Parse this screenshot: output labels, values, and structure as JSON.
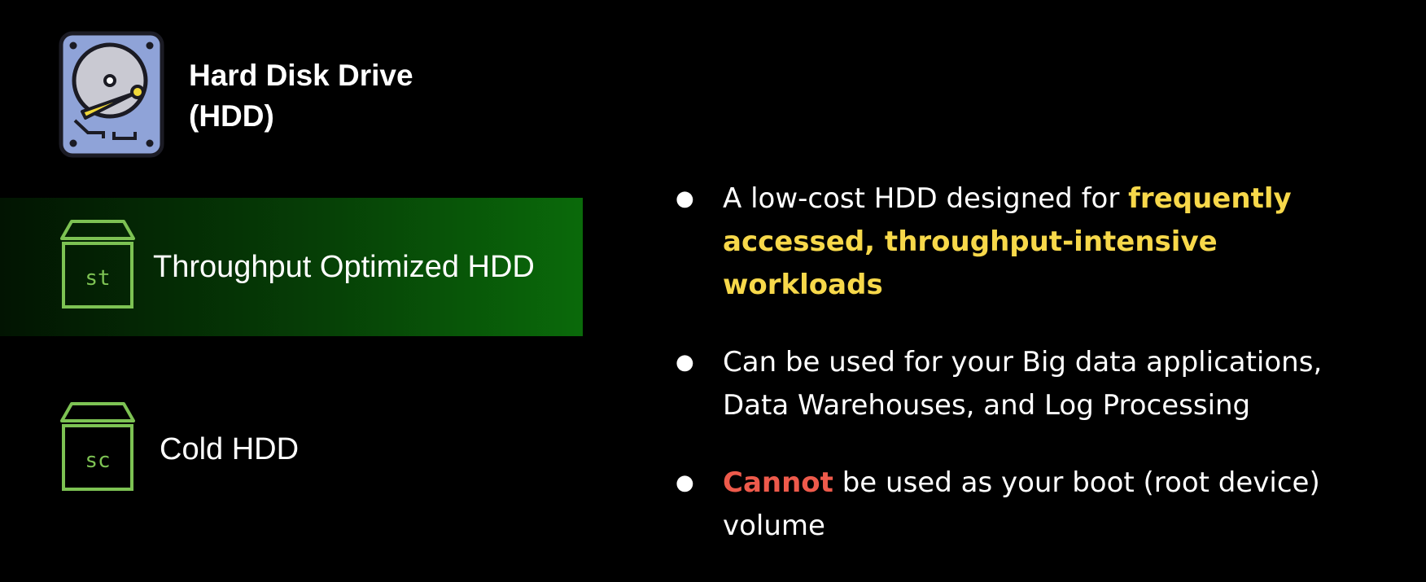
{
  "header": {
    "icon": "hard-disk-drive-icon",
    "title_line1": "Hard Disk Drive",
    "title_line2": "(HDD)"
  },
  "volume_types": [
    {
      "code": "st",
      "label": "Throughput Optimized HDD",
      "icon": "volume-box-icon",
      "selected": true
    },
    {
      "code": "sc",
      "label": "Cold HDD",
      "icon": "volume-box-icon",
      "selected": false
    }
  ],
  "bullets": [
    {
      "text_before": "A low-cost HDD designed for ",
      "highlight": "frequently accessed, throughput-intensive workloads",
      "text_after": ""
    },
    {
      "text": "Can be used for your Big data applications, Data Warehouses, and Log Processing"
    },
    {
      "highlight": "Cannot",
      "text_after": " be used as your boot (root device) volume"
    }
  ],
  "colors": {
    "background": "#000000",
    "highlight_yellow": "#f7d84a",
    "highlight_red": "#ee5a4b",
    "icon_green": "#7dc253",
    "selected_row_green": "#0a6a0a",
    "hdd_icon_body": "#8fa3d8",
    "hdd_icon_arm": "#f0d83a"
  }
}
